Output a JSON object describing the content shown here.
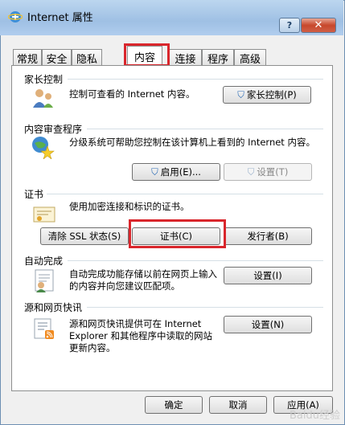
{
  "window": {
    "title": "Internet 属性"
  },
  "tabs": [
    {
      "label": "常规"
    },
    {
      "label": "安全"
    },
    {
      "label": "隐私"
    },
    {
      "label": "内容"
    },
    {
      "label": "连接"
    },
    {
      "label": "程序"
    },
    {
      "label": "高级"
    }
  ],
  "active_tab": "内容",
  "parental": {
    "title": "家长控制",
    "description": "控制可查看的 Internet 内容。",
    "button": "家长控制(P)"
  },
  "content_advisor": {
    "title": "内容审查程序",
    "description": "分级系统可帮助您控制在该计算机上看到的 Internet 内容。",
    "enable_button": "启用(E)...",
    "settings_button": "设置(T)"
  },
  "certificates": {
    "title": "证书",
    "description": "使用加密连接和标识的证书。",
    "clear_ssl_button": "清除 SSL 状态(S)",
    "certificates_button": "证书(C)",
    "publishers_button": "发行者(B)"
  },
  "autocomplete": {
    "title": "自动完成",
    "description": "自动完成功能存储以前在网页上输入的内容并向您建议匹配项。",
    "settings_button": "设置(I)"
  },
  "feeds": {
    "title": "源和网页快讯",
    "description": "源和网页快讯提供可在 Internet Explorer 和其他程序中读取的网站更新内容。",
    "settings_button": "设置(N)"
  },
  "footer": {
    "ok_button": "确定",
    "cancel_button": "取消",
    "apply_button": "应用(A)"
  },
  "watermark": "Baidu经验",
  "colors": {
    "highlight_box": "#d9262c",
    "title_gradient": "#9fc0e4",
    "close_button": "#c7472c"
  }
}
